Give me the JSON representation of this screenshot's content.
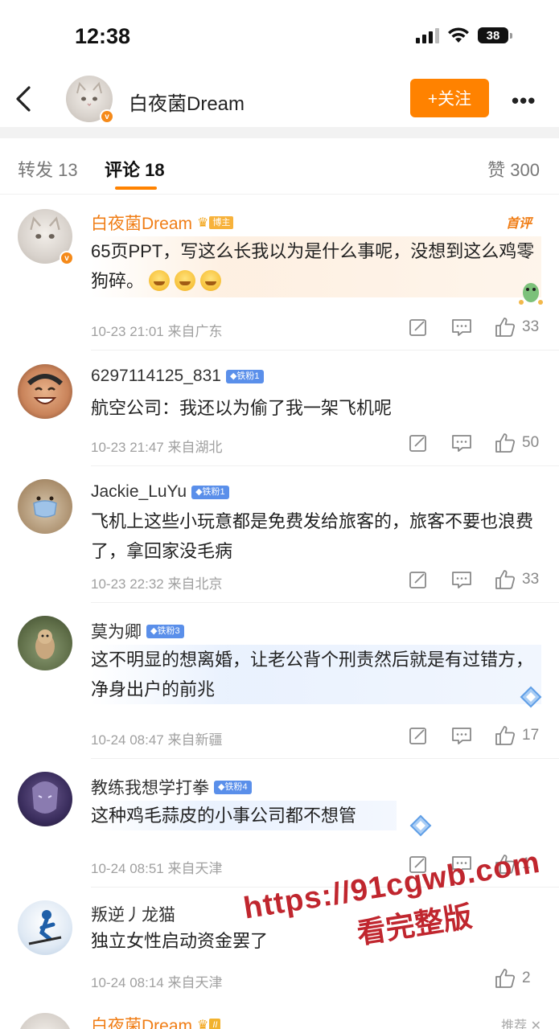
{
  "status": {
    "time": "12:38",
    "battery": "38"
  },
  "header": {
    "name": "白夜菌Dream",
    "follow_label": "+关注",
    "more": "•••"
  },
  "tabs": {
    "repost": "转发 13",
    "comments": "评论 18",
    "likes": "赞 300"
  },
  "comments": [
    {
      "name": "白夜菌Dream",
      "badge": "博主",
      "first_tag": "首评",
      "text": "65页PPT，写这么长我以为是什么事呢，没想到这么鸡零狗碎。",
      "time": "10-23 21:01 来自广东",
      "likes": "33"
    },
    {
      "name": "6297114125_831",
      "badge": "◆铁粉1",
      "text": "航空公司：我还以为偷了我一架飞机呢",
      "time": "10-23 21:47 来自湖北",
      "likes": "50"
    },
    {
      "name": "Jackie_LuYu",
      "badge": "◆铁粉1",
      "text": "飞机上这些小玩意都是免费发给旅客的，旅客不要也浪费了，拿回家没毛病",
      "time": "10-23 22:32 来自北京",
      "likes": "33"
    },
    {
      "name": "莫为卿",
      "badge": "◆铁粉3",
      "text": "这不明显的想离婚，让老公背个刑责然后就是有过错方，净身出户的前兆",
      "time": "10-24 08:47 来自新疆",
      "likes": "17"
    },
    {
      "name": "教练我想学打拳",
      "badge": "◆铁粉4",
      "text": "这种鸡毛蒜皮的小事公司都不想管",
      "time": "10-24 08:51 来自天津",
      "likes": "1"
    },
    {
      "name": "叛逆丿龙猫",
      "text": "独立女性启动资金罢了",
      "time": "10-24 08:14 来自天津",
      "likes": "2"
    },
    {
      "name": "白夜菌Dream",
      "badge": "II"
    }
  ],
  "watermark": {
    "url": "https://91cgwb.com",
    "sub": "看完整版"
  },
  "recommend": "推荐 ✕",
  "colors": {
    "accent": "#ff8200",
    "name_orange": "#f07d15",
    "fan_badge": "#5a8fea"
  },
  "icons": [
    "back-icon",
    "more-icon",
    "repost-icon",
    "comment-icon",
    "like-icon",
    "v-badge-icon",
    "crown-icon",
    "diamond-icon"
  ]
}
